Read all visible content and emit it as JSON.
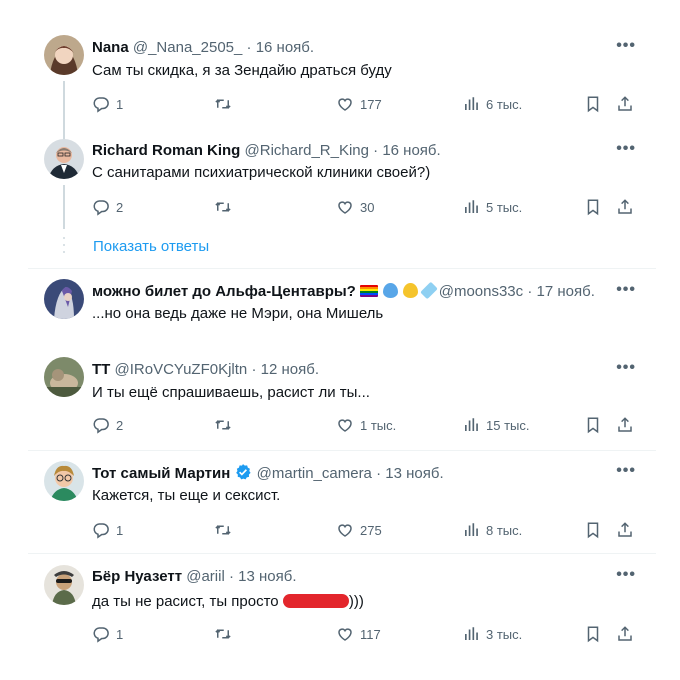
{
  "tweets": [
    {
      "name": "Nana",
      "handle": "@_Nana_2505_",
      "date": "16 нояб.",
      "text": "Сам ты скидка, я за Зендайю драться буду",
      "replies": "1",
      "retweets": "",
      "likes": "177",
      "views": "6 тыс."
    },
    {
      "name": "Richard Roman King",
      "handle": "@Richard_R_King",
      "date": "16 нояб.",
      "text": "С санитарами психиатрической клиники своей?)",
      "replies": "2",
      "retweets": "",
      "likes": "30",
      "views": "5 тыс."
    },
    {
      "name": "можно билет до Альфа-Центавры?",
      "handle": "@moons33c",
      "date": "17 нояб.",
      "text": "...но она ведь даже не Мэри, она Мишель"
    },
    {
      "name": "TT",
      "handle": "@IRoVCYuZF0Kjltn",
      "date": "12 нояб.",
      "text": "И ты ещё спрашиваешь, расист ли ты...",
      "replies": "2",
      "retweets": "",
      "likes": "1 тыс.",
      "views": "15 тыс."
    },
    {
      "name": "Тот самый Мартин",
      "handle": "@martin_camera",
      "date": "13 нояб.",
      "text": "Кажется, ты еще и сексист.",
      "replies": "1",
      "retweets": "",
      "likes": "275",
      "views": "8 тыс."
    },
    {
      "name": "Бёр Нуазетт",
      "handle": "@ariil",
      "date": "13 нояб.",
      "text": "да ты не расист, ты просто",
      "text_suffix": ")))",
      "replies": "1",
      "retweets": "",
      "likes": "117",
      "views": "3 тыс."
    }
  ],
  "show_replies_label": "Показать ответы",
  "separator_dot": "·",
  "more_label": "•••",
  "colors": {
    "link": "#1d9bf0",
    "secondary": "#536471",
    "redaction": "#e3262c"
  }
}
